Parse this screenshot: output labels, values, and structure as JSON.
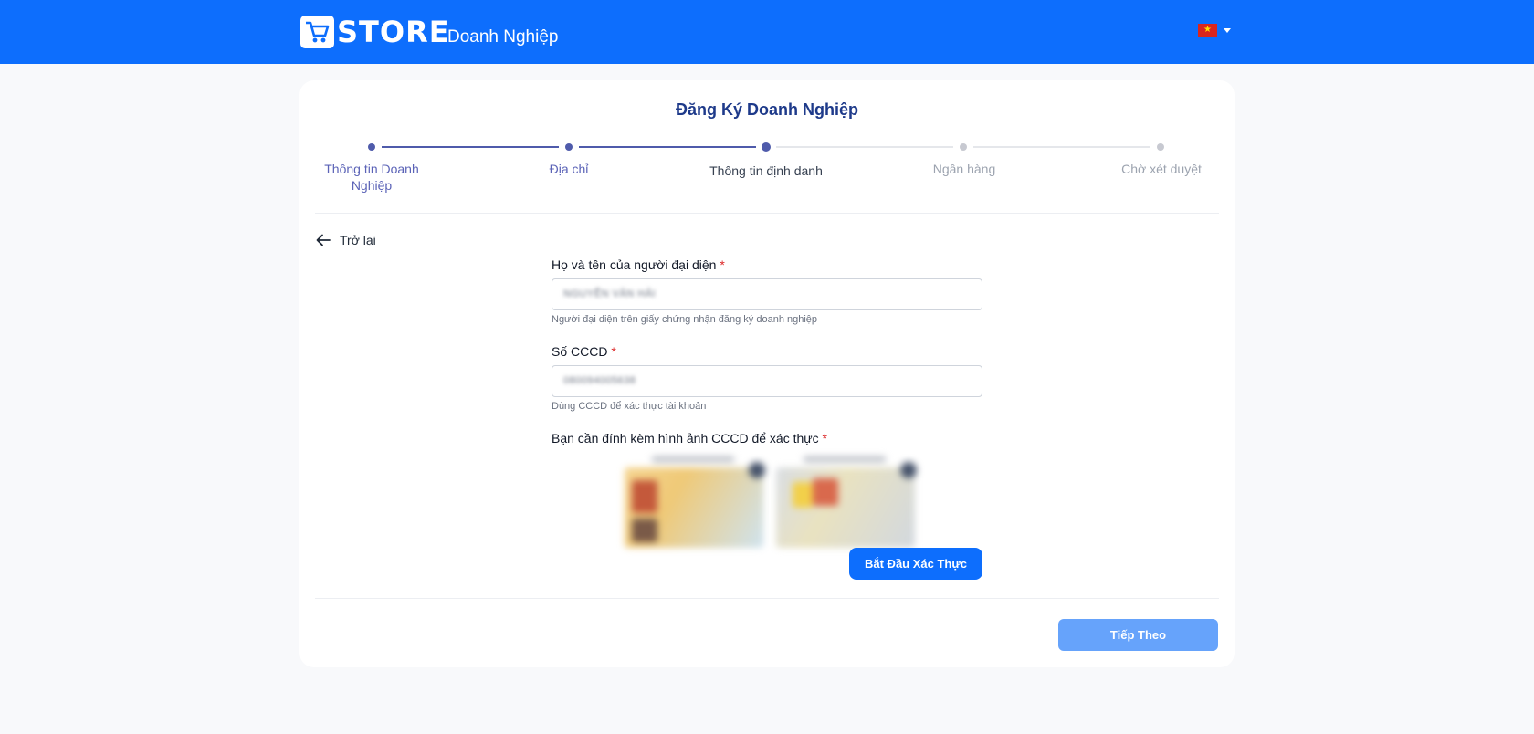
{
  "header": {
    "logo_text": "STORE",
    "subtitle": "Doanh Nghiệp",
    "language_flag": "vietnam-flag-icon"
  },
  "page": {
    "title": "Đăng Ký Doanh Nghiệp"
  },
  "stepper": {
    "steps": [
      {
        "label": "Thông tin Doanh Nghiệp",
        "state": "done"
      },
      {
        "label": "Địa chỉ",
        "state": "done"
      },
      {
        "label": "Thông tin định danh",
        "state": "active"
      },
      {
        "label": "Ngân hàng",
        "state": "pending"
      },
      {
        "label": "Chờ xét duyệt",
        "state": "pending"
      }
    ]
  },
  "back": {
    "label": "Trở lại"
  },
  "form": {
    "name": {
      "label": "Họ và tên của người đại diện",
      "required_mark": "*",
      "value": "NGUYỄN VĂN HẢI",
      "hint": "Người đại diện trên giấy chứng nhận đăng ký doanh nghiệp"
    },
    "cccd": {
      "label": "Số CCCD",
      "required_mark": "*",
      "value": "080094005638",
      "hint": "Dùng CCCD để xác thực tài khoản"
    },
    "attach": {
      "label": "Bạn cần đính kèm hình ảnh CCCD để xác thực",
      "required_mark": "*"
    },
    "verify_button": "Bắt Đầu Xác Thực"
  },
  "footer": {
    "next_button": "Tiếp Theo"
  },
  "colors": {
    "primary": "#0d6efd",
    "stepper_active": "#4f5bab",
    "next_disabled": "#66a3fb"
  }
}
